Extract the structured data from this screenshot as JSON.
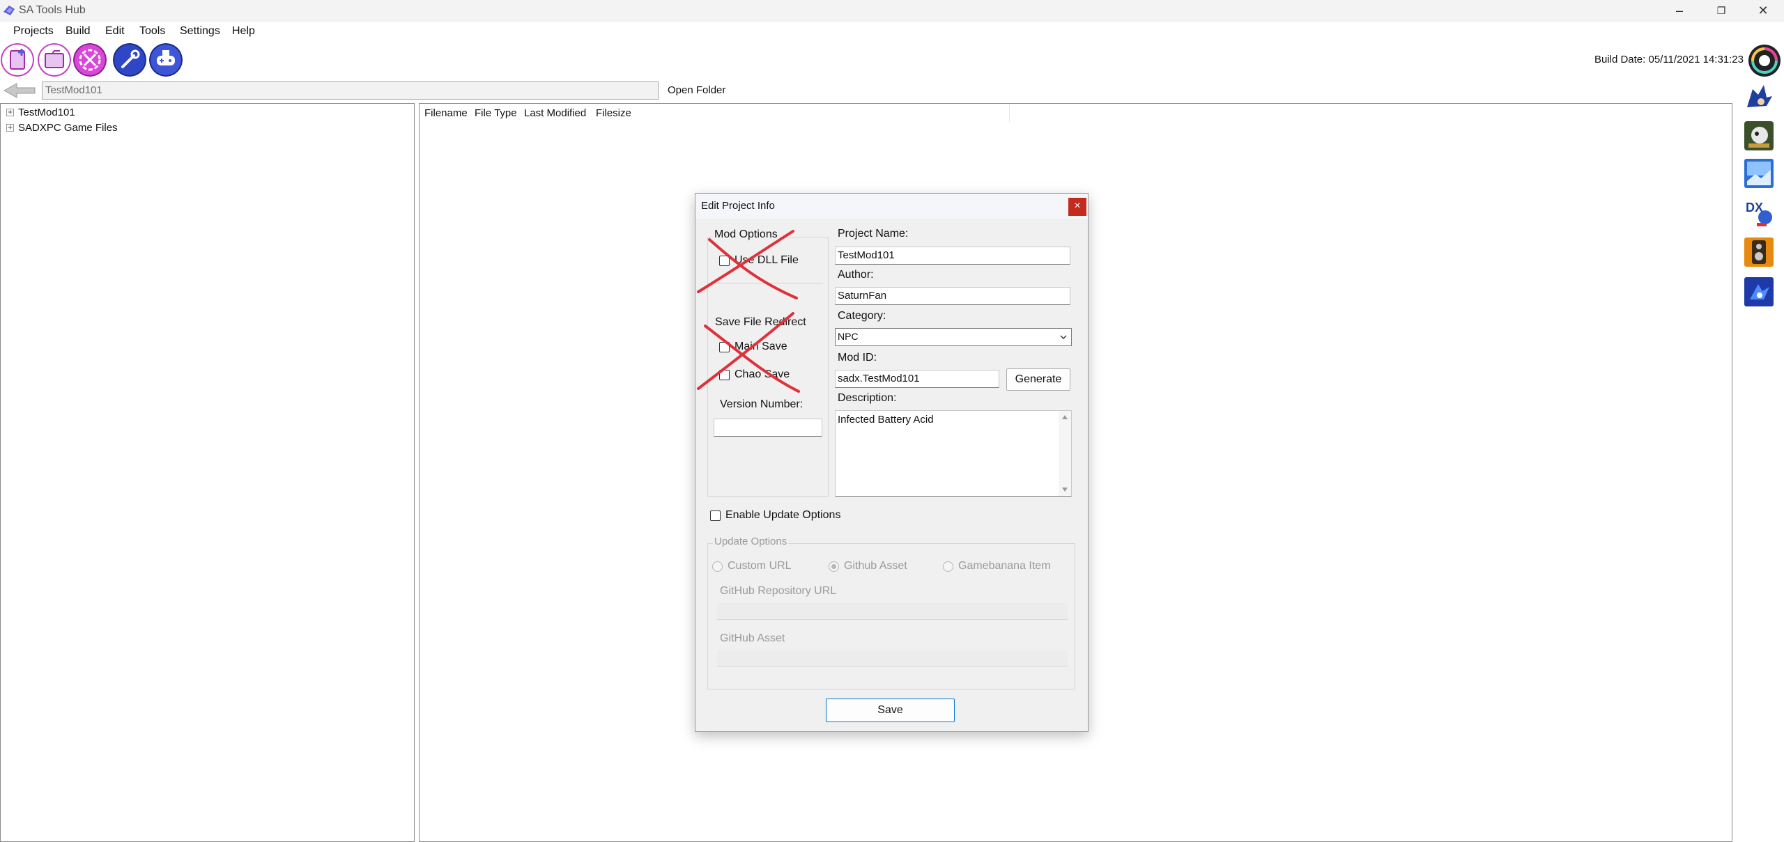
{
  "window": {
    "title": "SA Tools Hub",
    "minimize_glyph": "–",
    "restore_glyph": "❐",
    "close_glyph": "✕"
  },
  "menu": {
    "items": [
      "Projects",
      "Build",
      "Edit",
      "Tools",
      "Settings",
      "Help"
    ]
  },
  "toolbar": {
    "icons": [
      "new-project-icon",
      "open-project-icon",
      "tools-icon",
      "wrench-icon",
      "controller-icon"
    ],
    "build_date": "Build Date: 05/11/2021 14:31:23"
  },
  "address": {
    "path": "TestMod101",
    "open_folder": "Open Folder"
  },
  "tree": {
    "items": [
      {
        "label": "TestMod101",
        "expander": "+"
      },
      {
        "label": "SADXPC Game Files",
        "expander": "+"
      }
    ]
  },
  "file_list": {
    "columns": [
      "Filename",
      "File Type",
      "Last Modified",
      "Filesize"
    ]
  },
  "side_icons": [
    "sonic-icon",
    "game-icon",
    "texture-icon",
    "sadx-icon",
    "speaker-icon",
    "sonic-blue-icon"
  ],
  "dialog": {
    "title": "Edit Project Info",
    "close_glyph": "×",
    "mod_options": {
      "legend": "Mod Options",
      "use_dll_label": "Use DLL File",
      "save_redirect_label": "Save File Redirect",
      "main_save_label": "Main Save",
      "chao_save_label": "Chao Save",
      "version_label": "Version Number:",
      "version_value": ""
    },
    "project_name_label": "Project Name:",
    "project_name_value": "TestMod101",
    "author_label": "Author:",
    "author_value": "SaturnFan",
    "category_label": "Category:",
    "category_value": "NPC",
    "mod_id_label": "Mod ID:",
    "mod_id_value": "sadx.TestMod101",
    "generate_label": "Generate",
    "description_label": "Description:",
    "description_value": "Infected Battery Acid",
    "enable_update_label": "Enable Update Options",
    "update_options": {
      "legend": "Update Options",
      "radio_custom": "Custom URL",
      "radio_github": "Github Asset",
      "radio_gamebanana": "Gamebanana Item",
      "repo_url_label": "GitHub Repository URL",
      "asset_label": "GitHub Asset"
    },
    "save_label": "Save",
    "annotation_color": "#e0303a"
  }
}
